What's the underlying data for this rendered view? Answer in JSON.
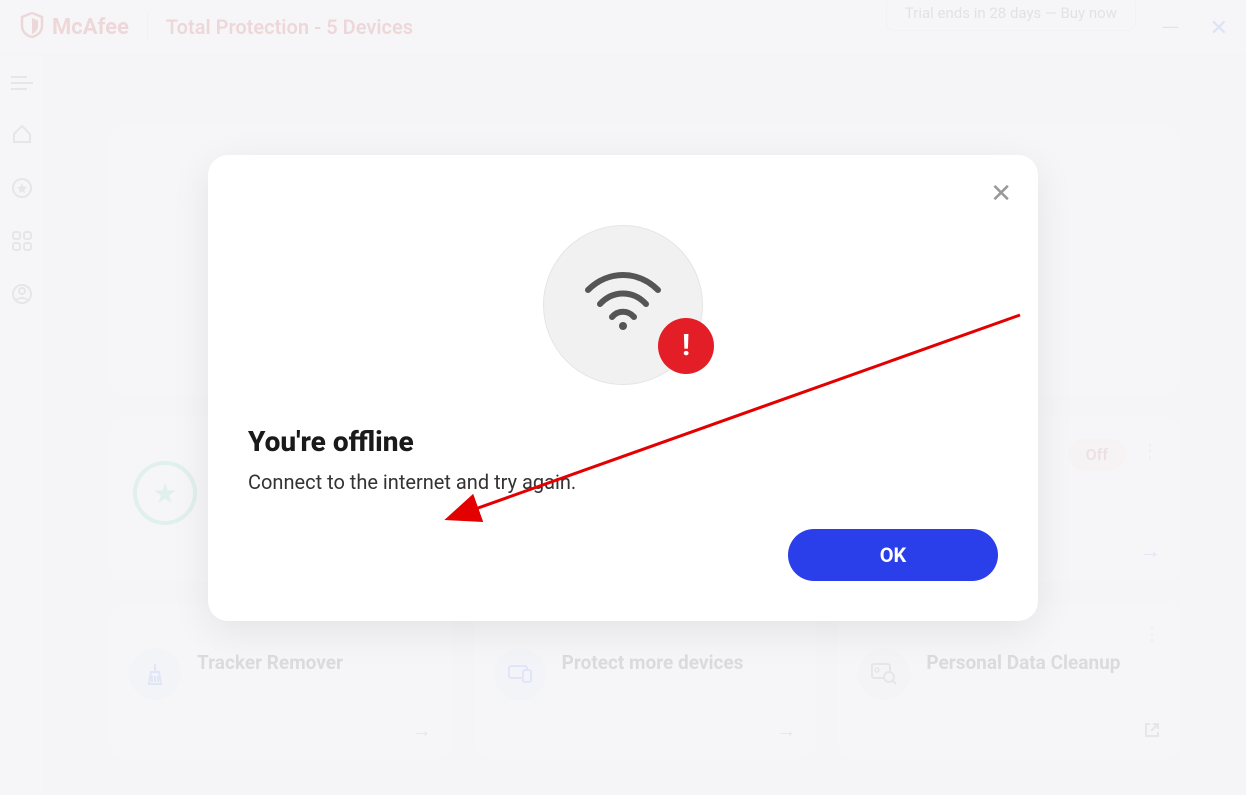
{
  "header": {
    "brand": "McAfee",
    "product": "Total Protection - 5 Devices",
    "trial_button": "Trial ends in 28 days — Buy now"
  },
  "mid_card": {
    "status_badge": "Off"
  },
  "cards": {
    "tracker": {
      "title": "Tracker Remover"
    },
    "protect": {
      "title": "Protect more devices"
    },
    "cleanup": {
      "title": "Personal Data Cleanup"
    }
  },
  "modal": {
    "title": "You're offline",
    "body": "Connect to the internet and try again.",
    "ok": "OK",
    "alert_symbol": "!"
  }
}
